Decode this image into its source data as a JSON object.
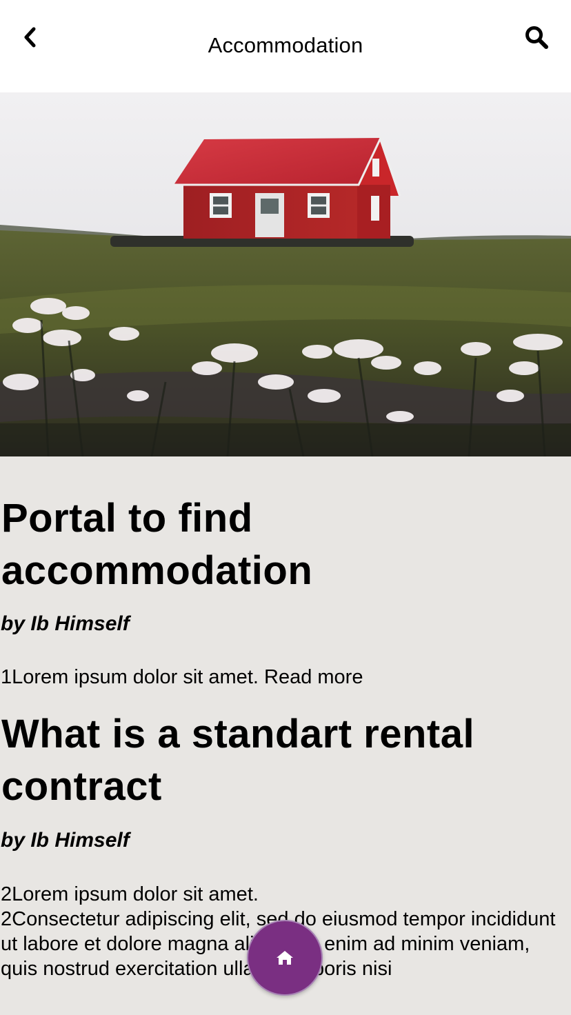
{
  "header": {
    "title": "Accommodation",
    "back_icon": "chevron-left-icon",
    "search_icon": "search-icon"
  },
  "hero": {
    "description_icon": "red-house-on-hill-photo"
  },
  "articles": [
    {
      "title": "Portal to find accommodation",
      "author": "by Ib Himself",
      "excerpt": "1Lorem ipsum dolor sit amet.",
      "read_more": "Read more"
    },
    {
      "title": "What is a standart rental contract",
      "author": "by Ib Himself",
      "excerpt_lines": [
        "2Lorem ipsum dolor sit amet.",
        "2Consectetur adipiscing elit, sed do eiusmod tempor incididunt ut labore et dolore magna aliqua. Ut enim ad minim veniam, quis nostrud exercitation ullamco laboris nisi"
      ]
    }
  ],
  "fab": {
    "icon": "home-icon"
  },
  "colors": {
    "fab": "#7a2f82",
    "background": "#e8e6e3",
    "header": "#ffffff"
  }
}
